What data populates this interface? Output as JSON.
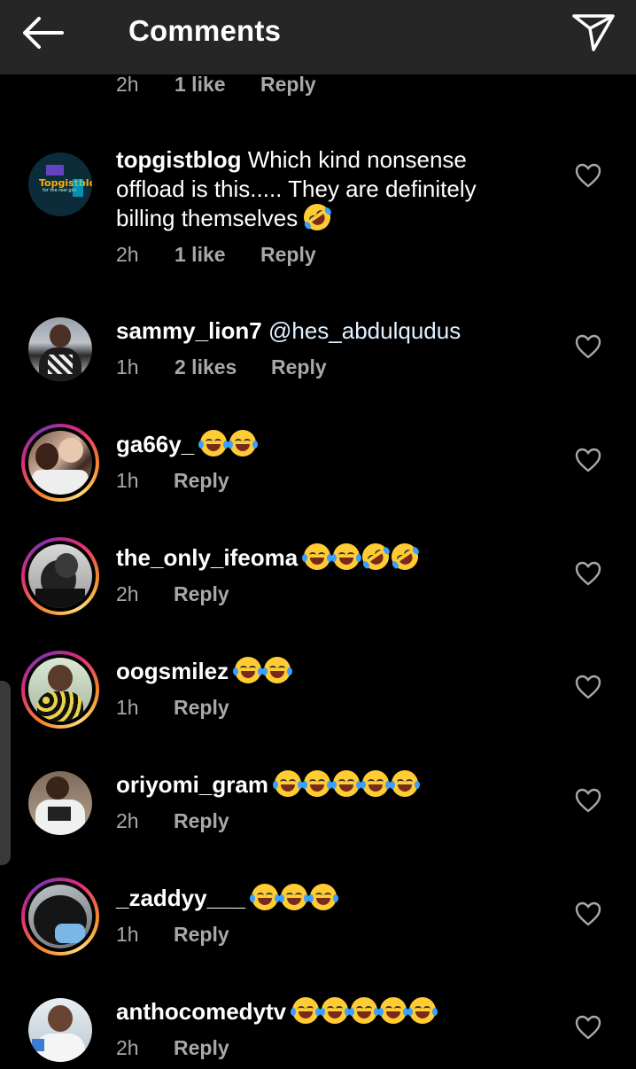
{
  "header": {
    "title": "Comments",
    "back_icon": "back-arrow-icon",
    "send_icon": "paper-plane-icon"
  },
  "top_meta": {
    "time": "2h",
    "likes": "1 like",
    "reply": "Reply"
  },
  "colors": {
    "topbar": "#262626",
    "meta": "#a8a8a8",
    "ring_start": "#f58529",
    "ring_end": "#8134af"
  },
  "comments": [
    {
      "username": "topgistblog",
      "text": "Which kind nonsense offload is this..... They are definitely billing themselves",
      "emoji": [
        "rofl"
      ],
      "time": "2h",
      "likes": "1 like",
      "reply": "Reply",
      "story_ring": false,
      "avatar_text": "Topgistblog",
      "avatar_subtext": "for the real gist"
    },
    {
      "username": "sammy_lion7",
      "text": "@hes_abdulqudus",
      "emoji": [],
      "time": "1h",
      "likes": "2 likes",
      "reply": "Reply",
      "story_ring": false
    },
    {
      "username": "ga66y_",
      "text": "",
      "emoji": [
        "tears-of-joy",
        "tears-of-joy"
      ],
      "time": "1h",
      "likes": "",
      "reply": "Reply",
      "story_ring": true
    },
    {
      "username": "the_only_ifeoma",
      "text": "",
      "emoji": [
        "tears-of-joy",
        "tears-of-joy",
        "rofl",
        "rofl"
      ],
      "time": "2h",
      "likes": "",
      "reply": "Reply",
      "story_ring": true
    },
    {
      "username": "oogsmilez",
      "text": "",
      "emoji": [
        "tears-of-joy",
        "tears-of-joy"
      ],
      "time": "1h",
      "likes": "",
      "reply": "Reply",
      "story_ring": true
    },
    {
      "username": "oriyomi_gram",
      "text": "",
      "emoji": [
        "tears-of-joy",
        "tears-of-joy",
        "tears-of-joy",
        "tears-of-joy",
        "tears-of-joy"
      ],
      "time": "2h",
      "likes": "",
      "reply": "Reply",
      "story_ring": false
    },
    {
      "username": "_zaddyy___",
      "text": "",
      "emoji": [
        "tears-of-joy",
        "tears-of-joy",
        "tears-of-joy"
      ],
      "time": "1h",
      "likes": "",
      "reply": "Reply",
      "story_ring": true
    },
    {
      "username": "anthocomedytv",
      "text": "",
      "emoji": [
        "tears-of-joy",
        "tears-of-joy",
        "tears-of-joy",
        "tears-of-joy",
        "tears-of-joy"
      ],
      "time": "2h",
      "likes": "",
      "reply": "Reply",
      "story_ring": false
    }
  ]
}
